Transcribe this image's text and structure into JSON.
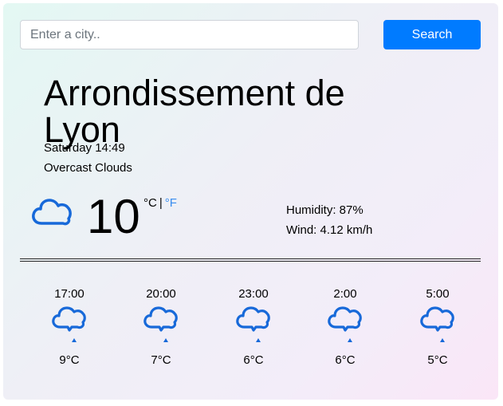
{
  "search": {
    "placeholder": "Enter a city..",
    "value": "",
    "button_label": "Search"
  },
  "current": {
    "city": "Arrondissement de Lyon",
    "datetime": "Saturday 14:49",
    "description": "Overcast Clouds",
    "icon": "cloud-icon",
    "temperature": "10",
    "unit_celsius": "°C",
    "unit_separator": "|",
    "unit_fahrenheit": "°F",
    "humidity": "Humidity: 87%",
    "wind": "Wind: 4.12 km/h"
  },
  "forecast": [
    {
      "time": "17:00",
      "temp": "9°C",
      "icon": "rain-cloud-icon"
    },
    {
      "time": "20:00",
      "temp": "7°C",
      "icon": "rain-cloud-icon"
    },
    {
      "time": "23:00",
      "temp": "6°C",
      "icon": "rain-cloud-icon"
    },
    {
      "time": "2:00",
      "temp": "6°C",
      "icon": "rain-cloud-icon"
    },
    {
      "time": "5:00",
      "temp": "5°C",
      "icon": "rain-cloud-icon"
    }
  ],
  "colors": {
    "accent": "#007bff",
    "icon_blue": "#1769d9",
    "fahrenheit_link": "#3a8ef0"
  }
}
